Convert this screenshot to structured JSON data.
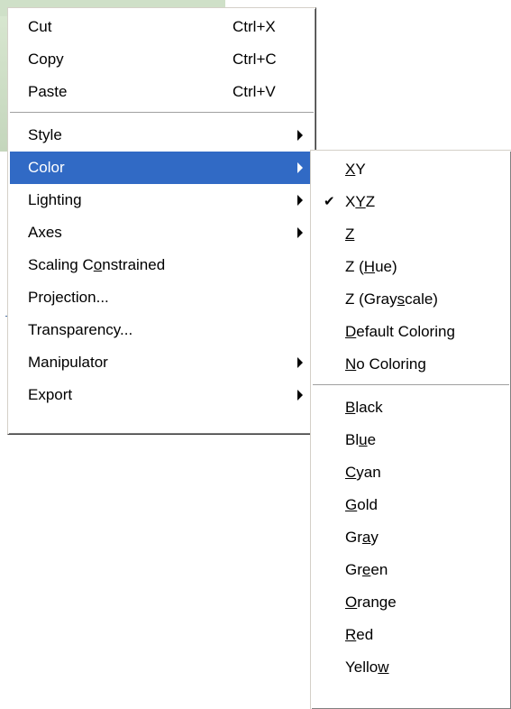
{
  "main_menu": {
    "cut": {
      "pre": "Cut",
      "shortcut": "Ctrl+X"
    },
    "copy": {
      "pre": "Copy",
      "shortcut": "Ctrl+C"
    },
    "paste": {
      "pre": "Paste",
      "shortcut": "Ctrl+V"
    },
    "style": {
      "pre": "Style"
    },
    "color": {
      "pre": "Color"
    },
    "lighting": {
      "pre": "Lighting"
    },
    "axes": {
      "pre": "Axes"
    },
    "scaling": {
      "pre": "Scaling C",
      "ul": "o",
      "post": "nstrained"
    },
    "projection": {
      "pre": "Projection..."
    },
    "transparency": {
      "pre": "Transparency..."
    },
    "manipulator": {
      "pre": "Manipulator"
    },
    "export": {
      "pre": "Export"
    }
  },
  "color_menu": {
    "xy": {
      "pre": "",
      "ul": "X",
      "post": "Y"
    },
    "xyz": {
      "pre": "X",
      "ul": "Y",
      "post": "Z",
      "checked": true,
      "check": "✔"
    },
    "z": {
      "pre": "",
      "ul": "Z",
      "post": ""
    },
    "z_hue": {
      "pre": "Z (",
      "ul": "H",
      "post": "ue)"
    },
    "z_gray": {
      "pre": "Z (Gray",
      "ul": "s",
      "post": "cale)"
    },
    "default": {
      "pre": "",
      "ul": "D",
      "post": "efault Coloring"
    },
    "none": {
      "pre": "",
      "ul": "N",
      "post": "o Coloring"
    },
    "black": {
      "pre": "",
      "ul": "B",
      "post": "lack"
    },
    "blue": {
      "pre": "Bl",
      "ul": "u",
      "post": "e"
    },
    "cyan": {
      "pre": "",
      "ul": "C",
      "post": "yan"
    },
    "gold": {
      "pre": "",
      "ul": "G",
      "post": "old"
    },
    "gray": {
      "pre": "Gr",
      "ul": "a",
      "post": "y"
    },
    "green": {
      "pre": "Gr",
      "ul": "e",
      "post": "en"
    },
    "orange": {
      "pre": "",
      "ul": "O",
      "post": "range"
    },
    "red": {
      "pre": "",
      "ul": "R",
      "post": "ed"
    },
    "yellow": {
      "pre": "Yello",
      "ul": "w",
      "post": ""
    }
  },
  "colors": {
    "highlight": "#316ac5",
    "menu_bg": "#ffffff",
    "separator": "#a0a0a0"
  }
}
